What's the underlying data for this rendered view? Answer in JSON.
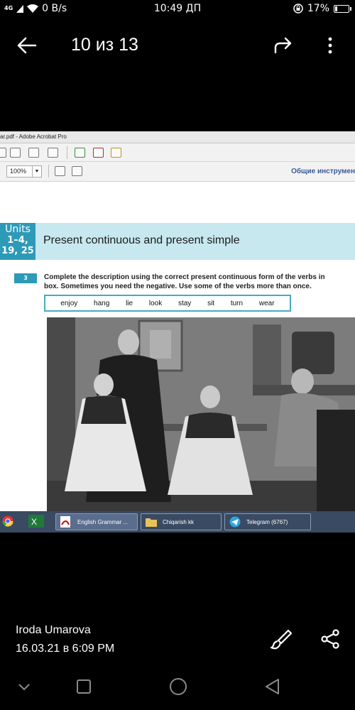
{
  "status_bar": {
    "network": "4G",
    "speed": "0 B/s",
    "time": "10:49 ДП",
    "battery": "17%",
    "battery_level": 0.17
  },
  "viewer": {
    "page_counter": "10 из 13"
  },
  "screenshot": {
    "window_title": "ar.pdf - Adobe Acrobat Pro",
    "zoom": "100%",
    "tools_link": "Общие инструмен",
    "units_label": "Units",
    "units_numbers": [
      "1–4,",
      "19, 25"
    ],
    "unit_title": "Present continuous and present simple",
    "exercise_number": "3",
    "instructions": [
      "Complete the description using the correct present continuous form of the verbs in",
      "box.  Sometimes you need the negative.  Use some of the verbs more than once."
    ],
    "verbs": [
      "enjoy",
      "hang",
      "lie",
      "look",
      "stay",
      "sit",
      "turn",
      "wear"
    ],
    "taskbar": [
      {
        "label": "English Grammar ...",
        "icon": "pdf-icon"
      },
      {
        "label": "Chiqarish kk",
        "icon": "folder-icon"
      },
      {
        "label": "Telegram (6767)",
        "icon": "telegram-icon"
      }
    ]
  },
  "meta": {
    "author": "Iroda Umarova",
    "date": "16.03.21 в 6:09 PM"
  }
}
